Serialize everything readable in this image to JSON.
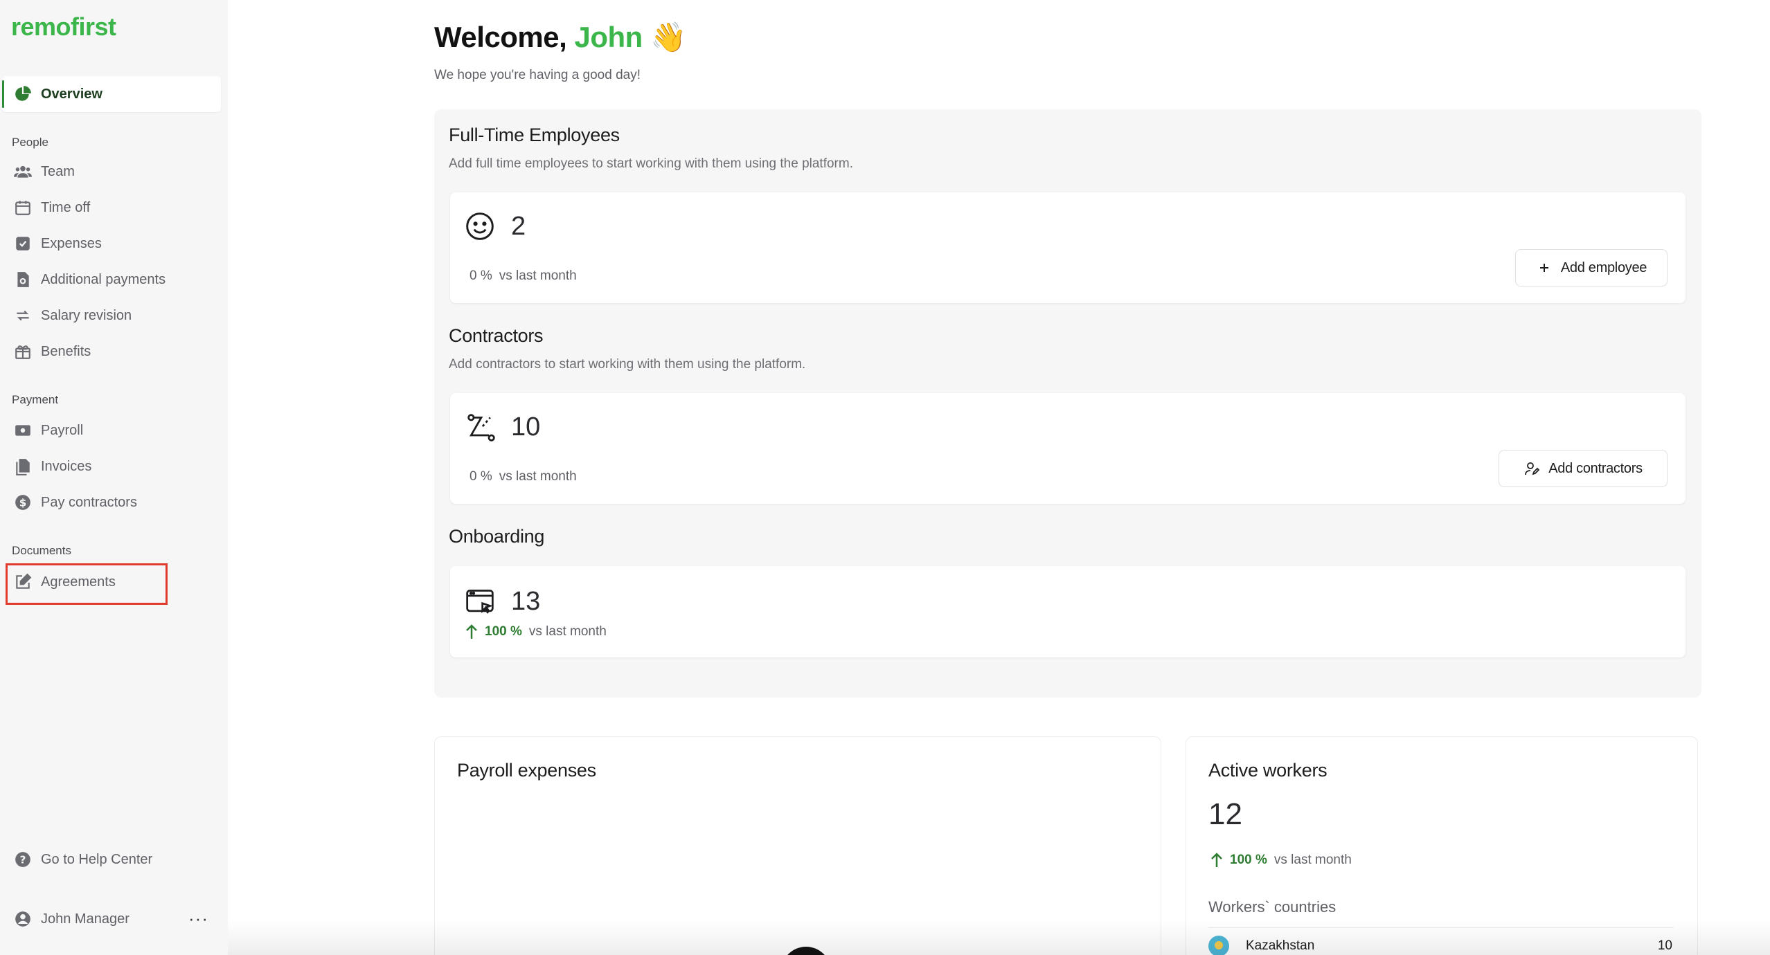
{
  "app": {
    "logo": "remofirst"
  },
  "sidebar": {
    "overview": "Overview",
    "sections": {
      "people": "People",
      "payment": "Payment",
      "documents": "Documents"
    },
    "people": [
      "Team",
      "Time off",
      "Expenses",
      "Additional payments",
      "Salary revision",
      "Benefits"
    ],
    "payment": [
      "Payroll",
      "Invoices",
      "Pay contractors"
    ],
    "documents": [
      "Agreements"
    ],
    "help": "Go to Help Center",
    "user": "John Manager",
    "menu_dots": "···"
  },
  "header": {
    "welcome_prefix": "Welcome,",
    "name": "John",
    "emoji": "👋",
    "subtitle": "We hope you're having a good day!"
  },
  "fulltime": {
    "title": "Full-Time Employees",
    "desc": "Add full time employees to start working with them using the platform.",
    "count": "2",
    "delta": "0 %",
    "vs": "vs last month",
    "button": "Add employee"
  },
  "contractors": {
    "title": "Contractors",
    "desc": "Add contractors to start working with them using the platform.",
    "count": "10",
    "delta": "0 %",
    "vs": "vs last month",
    "button": "Add contractors"
  },
  "onboarding": {
    "title": "Onboarding",
    "count": "13",
    "delta": "100 %",
    "vs": "vs last month"
  },
  "payroll_expenses": {
    "title": "Payroll expenses"
  },
  "active_workers": {
    "title": "Active workers",
    "count": "12",
    "delta": "100 %",
    "vs": "vs last month",
    "countries_title": "Workers` countries",
    "countries": [
      {
        "name": "Kazakhstan",
        "count": "10"
      }
    ]
  },
  "colors": {
    "brand": "#3cb64b",
    "positive": "#2e7d32",
    "highlight": "#e03b2e"
  }
}
